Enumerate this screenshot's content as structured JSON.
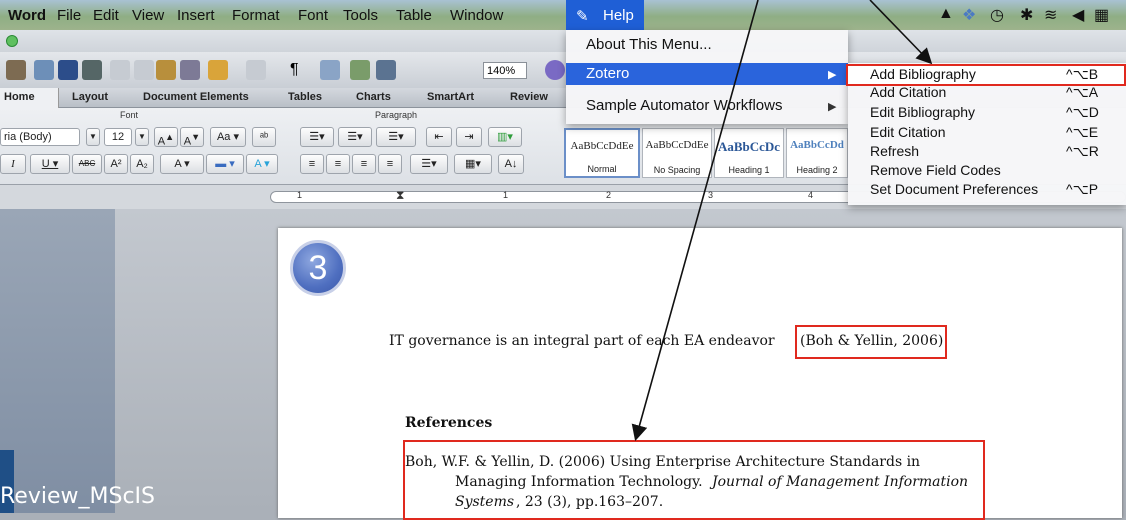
{
  "menubar": {
    "app": "Word",
    "items": [
      "File",
      "Edit",
      "View",
      "Insert",
      "Format",
      "Font",
      "Tools",
      "Table",
      "Window",
      "Help"
    ]
  },
  "toolbar": {
    "zoom": "140%"
  },
  "ribbon": {
    "tabs": [
      "Home",
      "Layout",
      "Document Elements",
      "Tables",
      "Charts",
      "SmartArt",
      "Review"
    ],
    "groups": {
      "font": "Font",
      "paragraph": "Paragraph"
    },
    "font_name": "ria (Body)",
    "font_size": "12",
    "styles": [
      {
        "sample": "AaBbCcDdEe",
        "name": "Normal"
      },
      {
        "sample": "AaBbCcDdEe",
        "name": "No Spacing"
      },
      {
        "sample": "AaBbCcDc",
        "name": "Heading 1"
      },
      {
        "sample": "AaBbCcDd",
        "name": "Heading 2"
      }
    ]
  },
  "ruler": {
    "numbers": [
      "1",
      "1",
      "2",
      "3",
      "4"
    ]
  },
  "help_menu": {
    "items": [
      "About This Menu...",
      "Zotero",
      "Sample Automator Workflows"
    ]
  },
  "zotero_submenu": {
    "items": [
      {
        "label": "Add Bibliography",
        "shortcut": "^⌥B"
      },
      {
        "label": "Add Citation",
        "shortcut": "^⌥A"
      },
      {
        "label": "Edit Bibliography",
        "shortcut": "^⌥D"
      },
      {
        "label": "Edit Citation",
        "shortcut": "^⌥E"
      },
      {
        "label": "Refresh",
        "shortcut": "^⌥R"
      },
      {
        "label": "Remove Field Codes",
        "shortcut": ""
      },
      {
        "label": "Set Document Preferences",
        "shortcut": "^⌥P"
      }
    ]
  },
  "document": {
    "step_number": "3",
    "sentence": "IT governance is an integral part of each EA endeavor",
    "citation": "(Boh & Yellin, 2006)",
    "references_heading": "References",
    "ref_line1": "Boh, W.F. & Yellin, D. (2006) Using Enterprise Architecture Standards in",
    "ref_line2a": "Managing Information Technology. ",
    "ref_line2b": "Journal of Management Information",
    "ref_line3a": "Systems",
    "ref_line3b": ", 23 (3), pp.163–207."
  },
  "footer_label": "Review_MScIS",
  "colors": {
    "accent_blue": "#2a64dc",
    "annotation_red": "#e0291e"
  }
}
